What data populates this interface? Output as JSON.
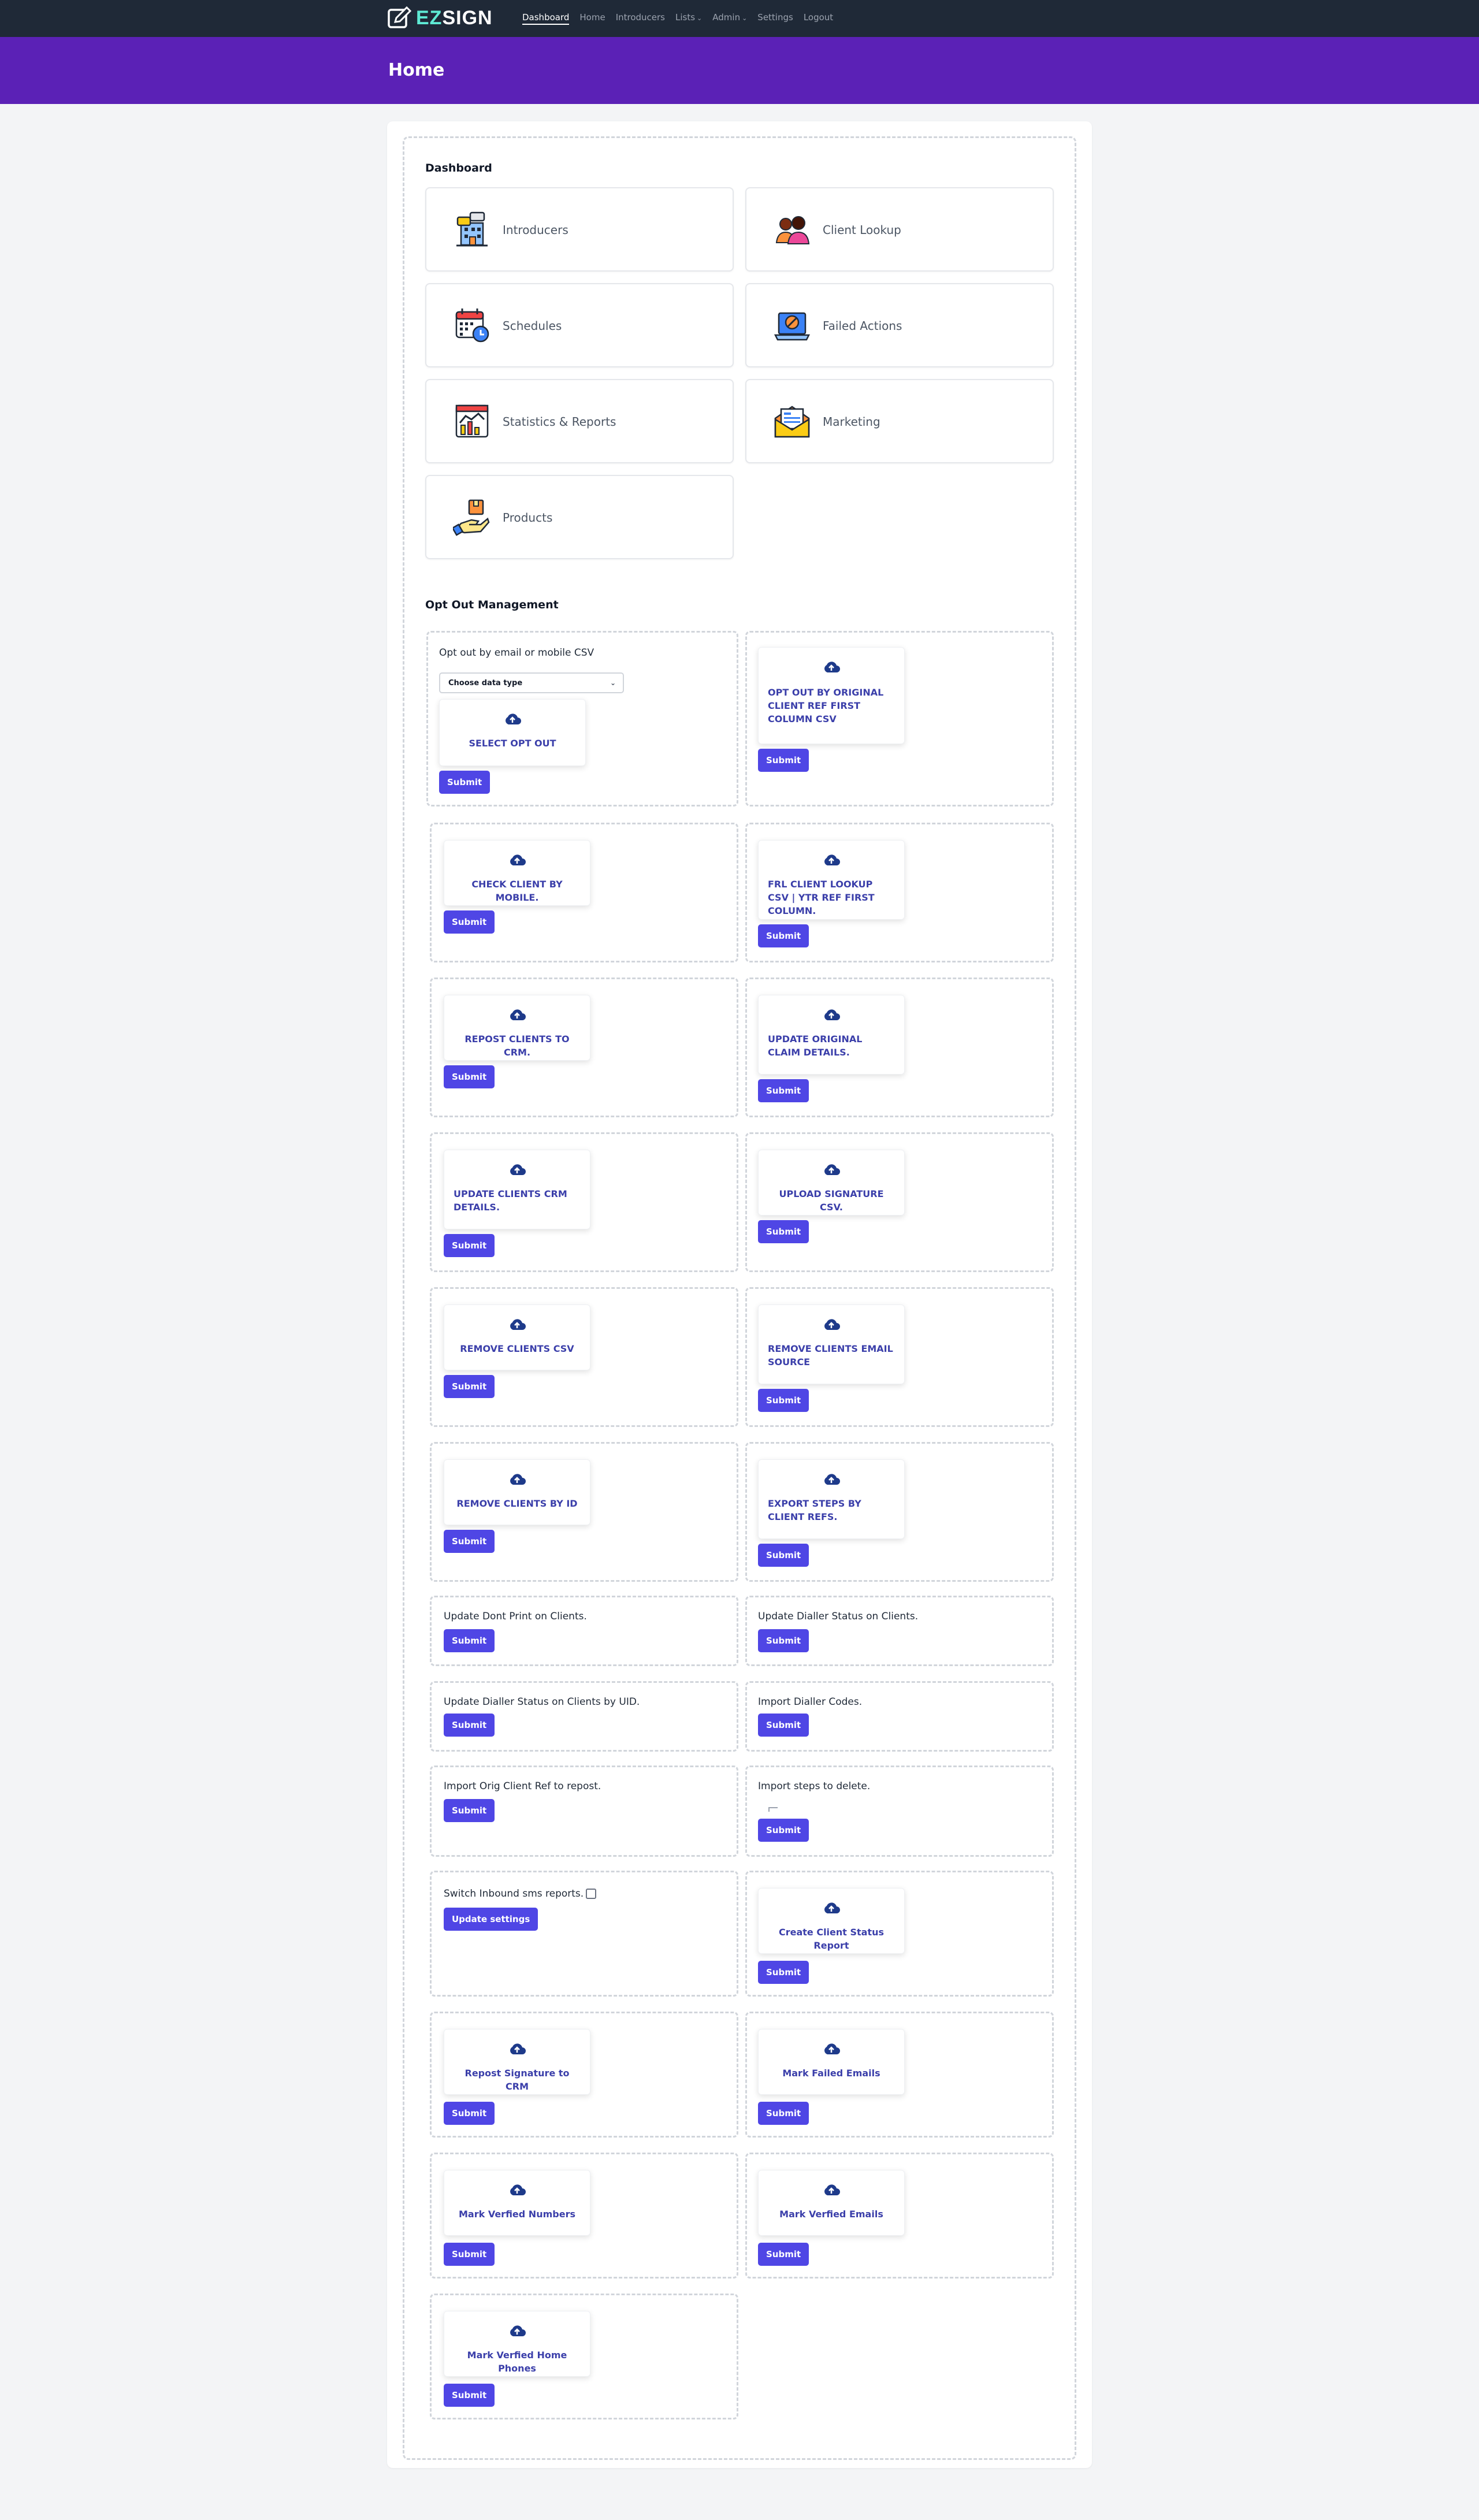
{
  "nav": {
    "brand_prefix": "EZ",
    "brand_suffix": "SIGN",
    "links": [
      "Dashboard",
      "Home",
      "Introducers",
      "Lists",
      "Admin",
      "Settings",
      "Logout"
    ]
  },
  "header": {
    "title": "Home"
  },
  "dashboard": {
    "title": "Dashboard",
    "tiles": [
      {
        "label": "Introducers",
        "icon": "building-icon"
      },
      {
        "label": "Client Lookup",
        "icon": "people-icon"
      },
      {
        "label": "Schedules",
        "icon": "calendar-clock-icon"
      },
      {
        "label": "Failed Actions",
        "icon": "laptop-error-icon"
      },
      {
        "label": "Statistics & Reports",
        "icon": "chart-icon"
      },
      {
        "label": "Marketing",
        "icon": "envelope-icon"
      },
      {
        "label": "Products",
        "icon": "hand-box-icon"
      }
    ]
  },
  "optout": {
    "title": "Opt Out Management",
    "box1_title": "Opt out by email or mobile CSV",
    "select_placeholder": "Choose data type",
    "submit": "Submit",
    "update_settings": "Update settings",
    "uploads": {
      "select_opt_out": "SELECT OPT OUT",
      "orig_client_ref": "OPT OUT BY ORIGINAL CLIENT REF FIRST COLUMN CSV",
      "check_mobile": "CHECK CLIENT BY MOBILE.",
      "frl_lookup": "FRL CLIENT LOOKUP CSV | YTR REF FIRST COLUMN.",
      "repost_crm": "REPOST CLIENTS TO CRM.",
      "update_claim": "UPDATE ORIGINAL CLAIM DETAILS.",
      "update_crm_details": "UPDATE CLIENTS CRM DETAILS.",
      "upload_signature": "UPLOAD SIGNATURE CSV.",
      "remove_csv": "REMOVE CLIENTS CSV",
      "remove_email_source": "REMOVE CLIENTS EMAIL SOURCE",
      "remove_by_id": "REMOVE CLIENTS BY ID",
      "export_steps": "EXPORT STEPS BY CLIENT REFS.",
      "client_status_report": "Create Client Status Report",
      "repost_signature": "Repost Signature to CRM",
      "mark_failed_emails": "Mark Failed Emails",
      "mark_verified_numbers": "Mark Verfied Numbers",
      "mark_verified_emails": "Mark Verfied Emails",
      "mark_verified_home": "Mark Verfied Home Phones"
    },
    "texts": {
      "dont_print": "Update Dont Print on Clients.",
      "dialler_status": "Update Dialler Status on Clients.",
      "dialler_status_uid": "Update Dialler Status on Clients by UID.",
      "import_dialler_codes": "Import Dialler Codes.",
      "import_orig_ref": "Import Orig Client Ref to repost.",
      "import_steps_delete": "Import steps to delete.",
      "switch_inbound": "Switch Inbound sms reports."
    }
  },
  "colors": {
    "nav_bg": "#1f2937",
    "header_bg": "#5b21b6",
    "button": "#4f46e5",
    "upload_text": "#3b3faa"
  }
}
